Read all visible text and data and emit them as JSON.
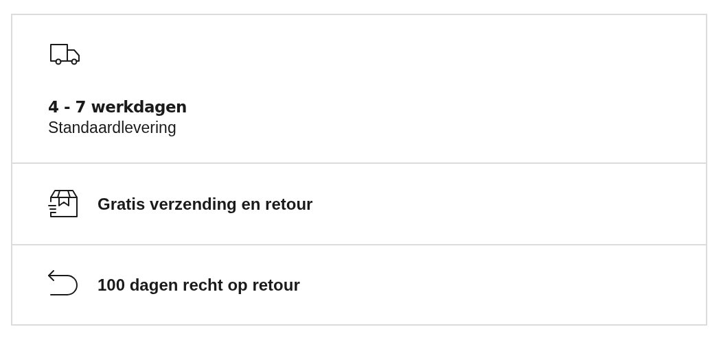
{
  "delivery": {
    "title": "4 - 7 werkdagen",
    "subtitle": "Standaardlevering"
  },
  "features": [
    {
      "label": "Gratis verzending en retour"
    },
    {
      "label": "100 dagen recht op retour"
    }
  ]
}
